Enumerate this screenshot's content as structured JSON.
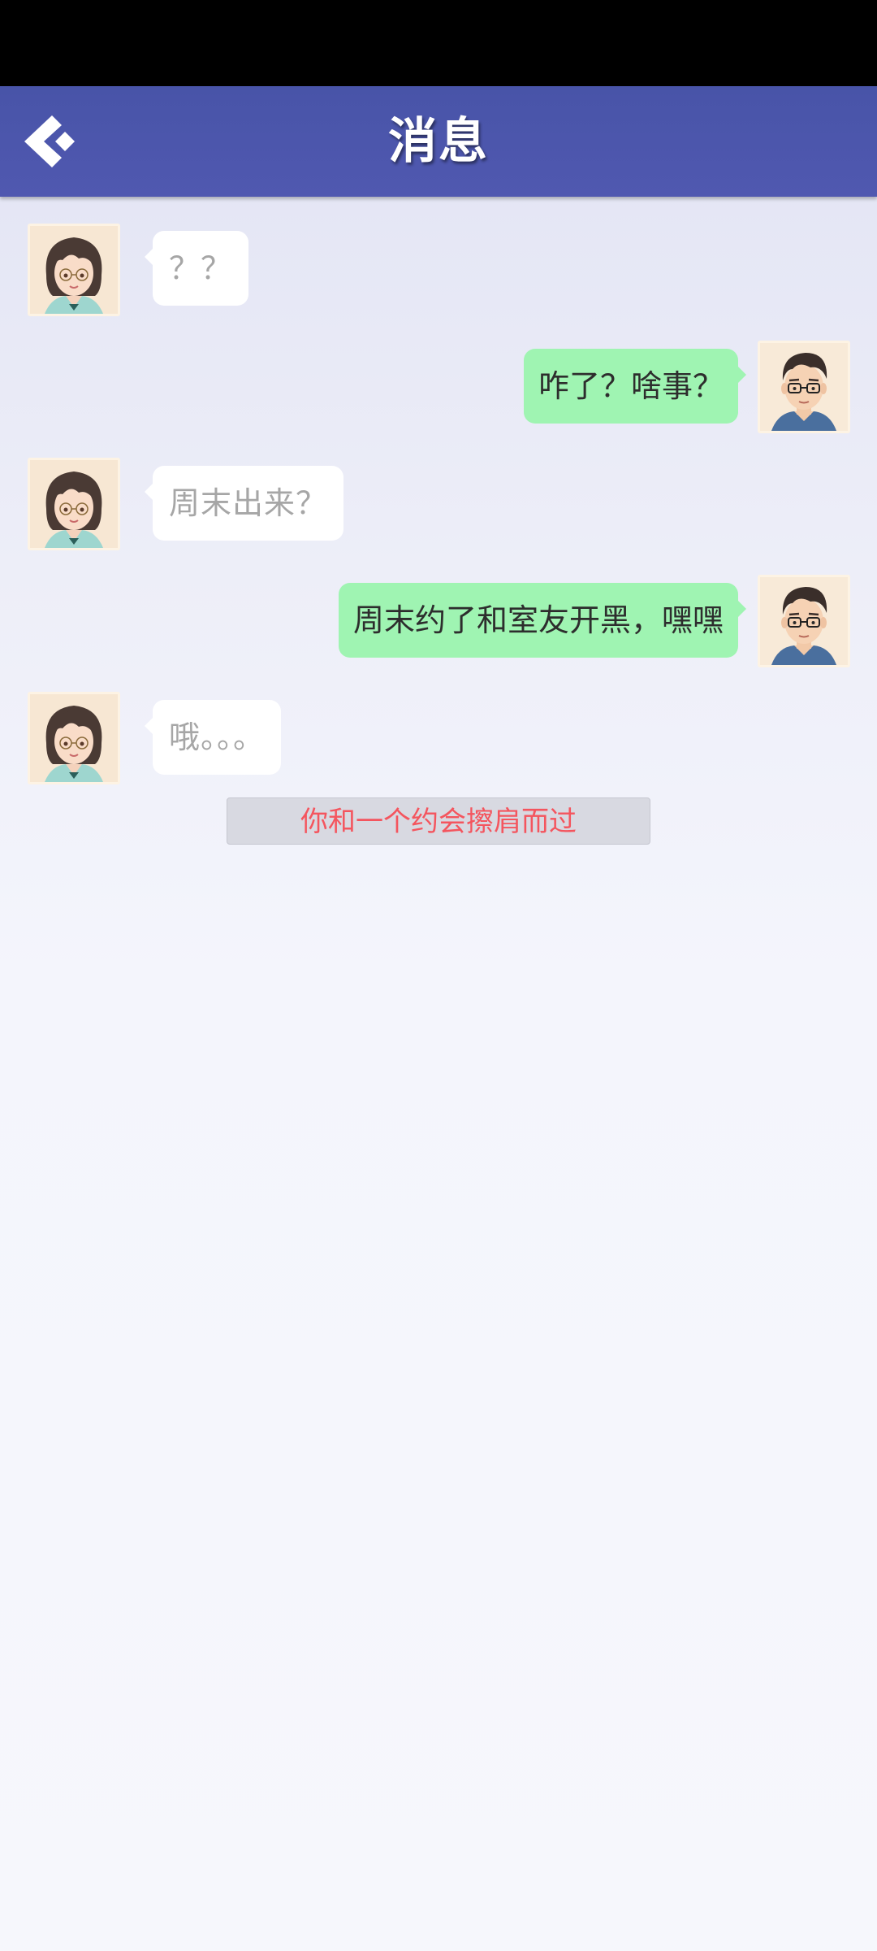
{
  "header": {
    "title": "消息",
    "back_icon": "back-chevron-icon"
  },
  "colors": {
    "header_bg": "#4c56ad",
    "incoming_bubble": "#ffffff",
    "outgoing_bubble": "#9ff4b2",
    "notice_text": "#f4555e"
  },
  "messages": [
    {
      "sender": "girl",
      "direction": "incoming",
      "text": "？？",
      "avatar_icon": "girl-avatar-icon"
    },
    {
      "sender": "me",
      "direction": "outgoing",
      "text": "咋了？啥事？",
      "avatar_icon": "boy-avatar-icon"
    },
    {
      "sender": "girl",
      "direction": "incoming",
      "text": "周末出来？",
      "avatar_icon": "girl-avatar-icon"
    },
    {
      "sender": "me",
      "direction": "outgoing",
      "text": "周末约了和室友开黑，嘿嘿",
      "avatar_icon": "boy-avatar-icon"
    },
    {
      "sender": "girl",
      "direction": "incoming",
      "text": "哦。。。",
      "avatar_icon": "girl-avatar-icon"
    }
  ],
  "system_notice": "你和一个约会擦肩而过"
}
